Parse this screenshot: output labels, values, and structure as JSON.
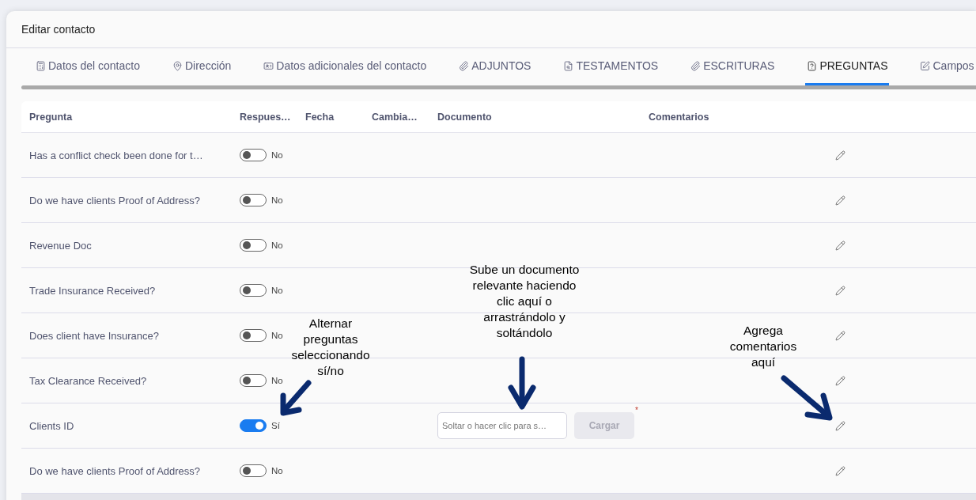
{
  "dialog": {
    "title": "Editar contacto"
  },
  "tabs": [
    {
      "label": "Datos del contacto",
      "selected": false
    },
    {
      "label": "Dirección",
      "selected": false
    },
    {
      "label": "Datos adicionales del contacto",
      "selected": false
    },
    {
      "label": "ADJUNTOS",
      "selected": false
    },
    {
      "label": "TESTAMENTOS",
      "selected": false
    },
    {
      "label": "ESCRITURAS",
      "selected": false
    },
    {
      "label": "PREGUNTAS",
      "selected": true
    },
    {
      "label": "Campos",
      "selected": false
    }
  ],
  "table": {
    "columns": [
      "Pregunta",
      "Respues…",
      "Fecha",
      "Cambia…",
      "Documento",
      "Comentarios"
    ],
    "rows": [
      {
        "question": "Has a conflict check been done for t…",
        "answer": {
          "on": false,
          "label": "No"
        }
      },
      {
        "question": "Do we have clients Proof of Address?",
        "answer": {
          "on": false,
          "label": "No"
        }
      },
      {
        "question": "Revenue Doc",
        "answer": {
          "on": false,
          "label": "No"
        }
      },
      {
        "question": "Trade Insurance Received?",
        "answer": {
          "on": false,
          "label": "No"
        }
      },
      {
        "question": "Does client have Insurance?",
        "answer": {
          "on": false,
          "label": "No"
        }
      },
      {
        "question": "Tax Clearance Received?",
        "answer": {
          "on": false,
          "label": "No"
        }
      },
      {
        "question": "Clients ID",
        "answer": {
          "on": true,
          "label": "Sí"
        },
        "document": {
          "placeholder": "Soltar o hacer clic para s…",
          "button": "Cargar",
          "button_disabled": true,
          "required_mark": "*"
        }
      },
      {
        "question": "Do we have clients Proof of Address?",
        "answer": {
          "on": false,
          "label": "No"
        }
      }
    ]
  },
  "annotations": [
    {
      "text": "Alternar preguntas seleccionando sí/no"
    },
    {
      "text": "Sube un documento relevante haciendo clic aquí o arrastrándolo y soltándolo"
    },
    {
      "text": "Agrega comentarios aquí"
    }
  ]
}
